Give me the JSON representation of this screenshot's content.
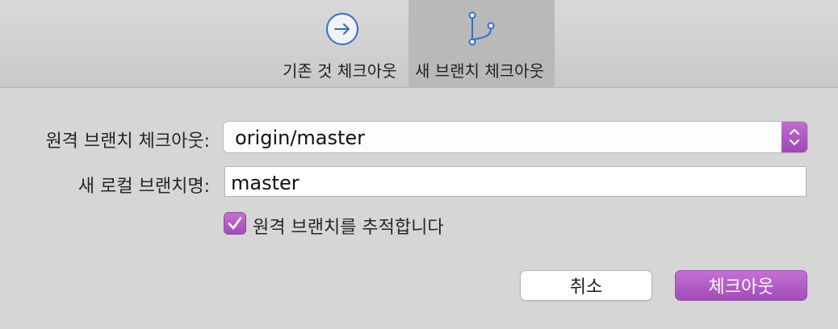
{
  "toolbar": {
    "tabs": [
      {
        "label": "기존 것 체크아웃",
        "icon": "arrow-circle-right-icon",
        "selected": false
      },
      {
        "label": "새 브랜치 체크아웃",
        "icon": "branch-icon",
        "selected": true
      }
    ]
  },
  "form": {
    "remote_branch_label": "원격 브랜치 체크아웃:",
    "remote_branch_value": "origin/master",
    "local_branch_label": "새 로컬 브랜치명:",
    "local_branch_value": "master",
    "track_label": "원격 브랜치를 추적합니다",
    "track_checked": true
  },
  "buttons": {
    "cancel": "취소",
    "checkout": "체크아웃"
  },
  "colors": {
    "accent": "#b05cc4",
    "icon_blue": "#2f6fcf",
    "background": "#d6d6d6"
  }
}
